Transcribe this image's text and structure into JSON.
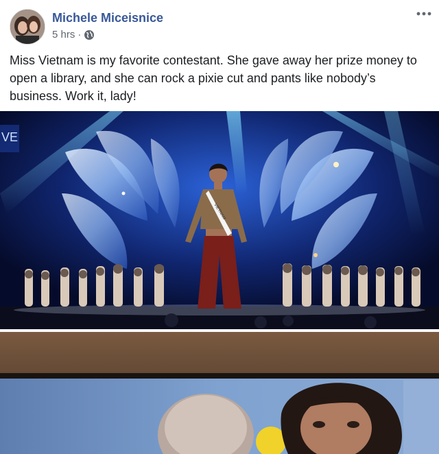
{
  "post": {
    "author": "Michele Miceisnice",
    "time": "5 hrs",
    "time_separator": "·",
    "privacy_icon": "globe-icon",
    "more_icon": "more-options-icon",
    "caption": "Miss Vietnam is my favorite contestant. She gave away her prize money to open a library, and she can rock a pixie cut and pants like nobody’s business. Work it, lady!"
  },
  "photo1": {
    "screen_text": "VE",
    "sash_text": "VIETNAM"
  },
  "colors": {
    "author_link": "#385898",
    "meta_gray": "#616770",
    "stage_blue": "#0a1640"
  }
}
